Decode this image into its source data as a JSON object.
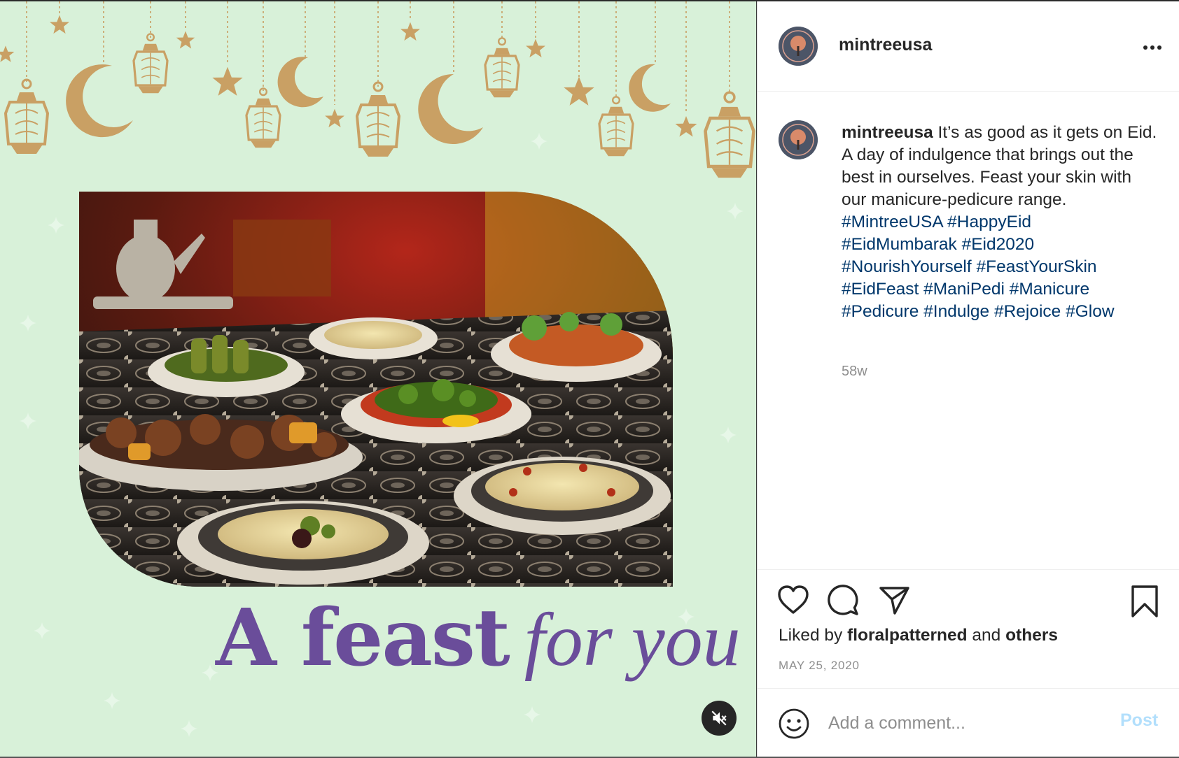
{
  "post": {
    "username": "mintreeusa",
    "caption": {
      "username": "mintreeusa",
      "text": "It’s as good as it gets on Eid. A day of indulgence that brings out the best in ourselves. Feast your skin with our manicure-pedicure range.",
      "hashtags": [
        "#MintreeUSA",
        "#HappyEid",
        "#EidMumbarak",
        "#Eid2020",
        "#NourishYourself",
        "#FeastYourSkin",
        "#EidFeast",
        "#ManiPedi",
        "#Manicure",
        "#Pedicure",
        "#Indulge",
        "#Rejoice",
        "#Glow"
      ]
    },
    "time_ago": "58w",
    "likes": {
      "prefix": "Liked by",
      "user": "floralpatterned",
      "joiner": "and",
      "others": "others"
    },
    "date": "MAY 25, 2020",
    "comment_placeholder": "Add a comment...",
    "post_label": "Post"
  },
  "media": {
    "headline_part1": "A feast",
    "headline_part2": "for you",
    "headline_color": "#6a4d9a",
    "background_color": "#d8f1d9",
    "ornament_color": "#c9a064"
  },
  "icons": [
    "more-options-icon",
    "heart-icon",
    "comment-icon",
    "share-icon",
    "bookmark-icon",
    "emoji-icon",
    "mute-icon"
  ],
  "colors": {
    "hashtag": "#00376b",
    "secondary_text": "#8e8e8e",
    "post_button_disabled": "#b2dffc"
  }
}
